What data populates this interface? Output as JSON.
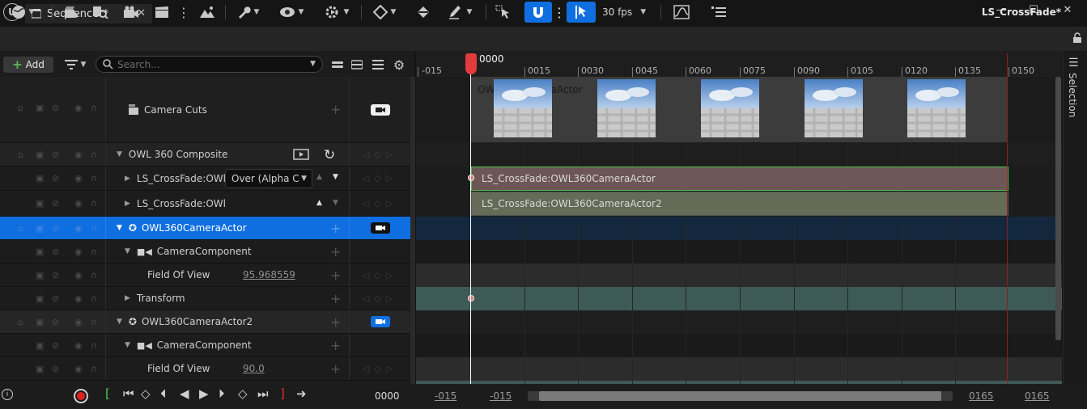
{
  "app": {
    "logo_text": "U",
    "tab_title": "Sequencer*"
  },
  "window": {
    "minimize": "—",
    "maximize": "☐",
    "close": "✕"
  },
  "toolbar": {
    "fps": "30 fps",
    "sequence_name": "LS_CrossFade*"
  },
  "left_header": {
    "add_label": "Add",
    "search_placeholder": "Search..."
  },
  "tracks": [
    {
      "label": "Camera Cuts"
    },
    {
      "label": "OWL 360 Composite"
    },
    {
      "label": "LS_CrossFade:OWl",
      "blend": "Over (Alpha C"
    },
    {
      "label": "LS_CrossFade:OWl"
    },
    {
      "label": "OWL360CameraActor"
    },
    {
      "label": "CameraComponent"
    },
    {
      "label": "Field Of View",
      "value": "95.968559"
    },
    {
      "label": "Transform"
    },
    {
      "label": "OWL360CameraActor2"
    },
    {
      "label": "CameraComponent"
    },
    {
      "label": "Field Of View",
      "value": "90.0"
    }
  ],
  "timeline": {
    "current_frame": "0000",
    "ruler_labels": [
      "-015",
      "0015",
      "0030",
      "0045",
      "0060",
      "0075",
      "0090",
      "0105",
      "0120",
      "0135",
      "0150"
    ],
    "camera_cut_label": "OWL360CameraActor",
    "sections": [
      "LS_CrossFade:OWL360CameraActor",
      "LS_CrossFade:OWL360CameraActor2"
    ]
  },
  "bottom": {
    "frame": "0000",
    "range_start_a": "-015",
    "range_start_b": "-015",
    "range_end_a": "0165",
    "range_end_b": "0165"
  },
  "right_panel": {
    "selection_label": "Selection"
  },
  "colors": {
    "accent": "#0f6fe0",
    "playhead": "#e23b3b",
    "section1": "#6e5656",
    "section2": "#666b57",
    "transform_track": "#3d5a56"
  }
}
